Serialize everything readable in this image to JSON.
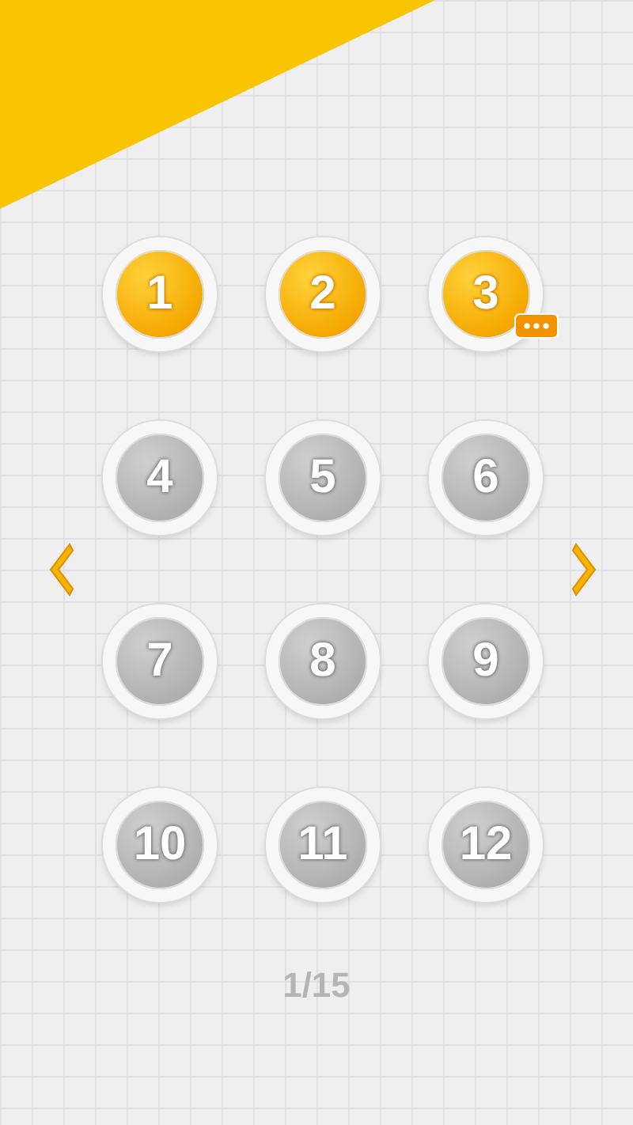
{
  "levels": [
    {
      "label": "1",
      "unlocked": true,
      "current": false
    },
    {
      "label": "2",
      "unlocked": true,
      "current": false
    },
    {
      "label": "3",
      "unlocked": true,
      "current": true
    },
    {
      "label": "4",
      "unlocked": false,
      "current": false
    },
    {
      "label": "5",
      "unlocked": false,
      "current": false
    },
    {
      "label": "6",
      "unlocked": false,
      "current": false
    },
    {
      "label": "7",
      "unlocked": false,
      "current": false
    },
    {
      "label": "8",
      "unlocked": false,
      "current": false
    },
    {
      "label": "9",
      "unlocked": false,
      "current": false
    },
    {
      "label": "10",
      "unlocked": false,
      "current": false
    },
    {
      "label": "11",
      "unlocked": false,
      "current": false
    },
    {
      "label": "12",
      "unlocked": false,
      "current": false
    }
  ],
  "page_indicator": "1/15"
}
